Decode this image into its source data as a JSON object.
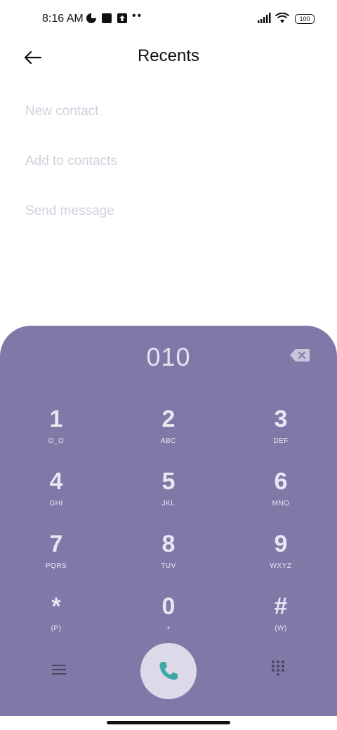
{
  "status": {
    "time": "8:16 AM",
    "battery": "100"
  },
  "header": {
    "title": "Recents"
  },
  "actions": [
    "New contact",
    "Add to contacts",
    "Send message"
  ],
  "dialer": {
    "number": "010",
    "keys": [
      {
        "digit": "1",
        "letters": "O_O"
      },
      {
        "digit": "2",
        "letters": "ABC"
      },
      {
        "digit": "3",
        "letters": "DEF"
      },
      {
        "digit": "4",
        "letters": "GHI"
      },
      {
        "digit": "5",
        "letters": "JKL"
      },
      {
        "digit": "6",
        "letters": "MNO"
      },
      {
        "digit": "7",
        "letters": "PQRS"
      },
      {
        "digit": "8",
        "letters": "TUV"
      },
      {
        "digit": "9",
        "letters": "WXYZ"
      },
      {
        "digit": "*",
        "letters": "(P)"
      },
      {
        "digit": "0",
        "letters": "+"
      },
      {
        "digit": "#",
        "letters": "(W)"
      }
    ]
  },
  "icons": {
    "back": "arrow-left-icon",
    "backspace": "backspace-icon",
    "call": "phone-icon",
    "menu": "menu-icon",
    "dialpad": "dialpad-icon"
  },
  "colors": {
    "dialer_bg": "#8178a8",
    "call_button_bg": "#ddd9e8",
    "call_icon": "#3aa9a8",
    "inactive_text": "#d2d0de"
  }
}
